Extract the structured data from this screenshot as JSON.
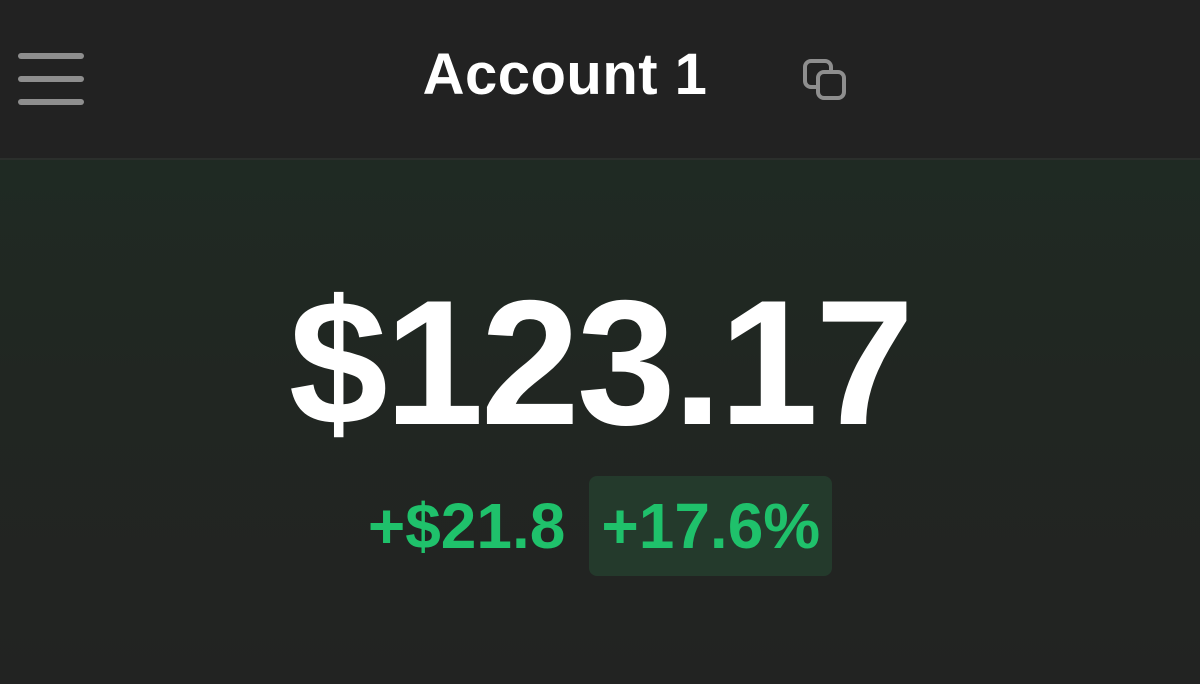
{
  "header": {
    "menu_icon": "hamburger-menu-icon",
    "title": "Account 1",
    "copy_icon": "copy-icon"
  },
  "balance": {
    "amount": "$123.17",
    "change_amount": "+$21.8",
    "change_percent": "+17.6%"
  },
  "colors": {
    "background": "#222322",
    "header_background": "#222222",
    "positive": "#1fc16b",
    "positive_badge_background": "#243a2c",
    "text_primary": "#ffffff",
    "icon_muted": "#8e8e8e"
  }
}
